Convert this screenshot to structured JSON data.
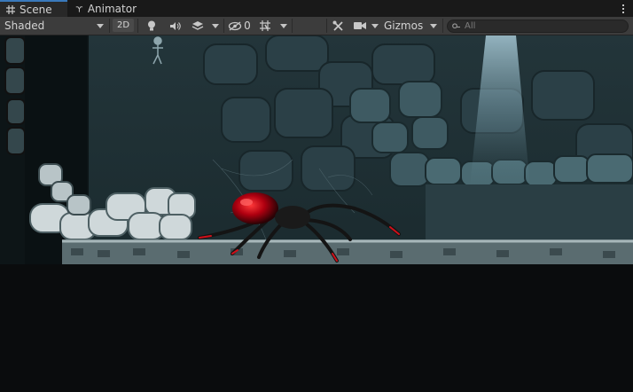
{
  "tabs": [
    {
      "label": "Scene",
      "icon": "grid-icon",
      "active": true
    },
    {
      "label": "Animator",
      "icon": "animator-icon",
      "active": false
    }
  ],
  "toolbar": {
    "shading_mode": "Shaded",
    "mode_2d_label": "2D",
    "hidden_count": "0",
    "gizmos_label": "Gizmos",
    "search_placeholder": "All"
  },
  "colors": {
    "accent": "#3a79bb",
    "toolbar_bg": "#3c3c3c",
    "tabbar_bg": "#191919",
    "spider_red": "#d0101a"
  }
}
